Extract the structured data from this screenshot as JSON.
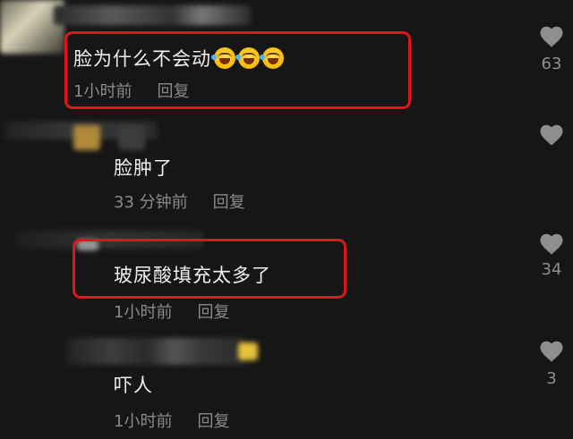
{
  "comments": [
    {
      "text": "脸为什么不会动",
      "emojis": [
        "rofl",
        "rofl",
        "rofl"
      ],
      "time": "1小时前",
      "reply_label": "回复",
      "likes": "63"
    },
    {
      "text": "脸肿了",
      "time": "33 分钟前",
      "reply_label": "回复",
      "likes": ""
    },
    {
      "text": "玻尿酸填充太多了",
      "time": "1小时前",
      "reply_label": "回复",
      "likes": "34"
    },
    {
      "text": "吓人",
      "time": "1小时前",
      "reply_label": "回复",
      "likes": "3"
    }
  ],
  "colors": {
    "background": "#161616",
    "highlight": "#e0141c",
    "meta_text": "#8a8a8a",
    "heart": "#8e8e8e"
  },
  "icons": {
    "like": "heart-icon",
    "emoji": "rolling-on-floor-laughing-emoji"
  }
}
